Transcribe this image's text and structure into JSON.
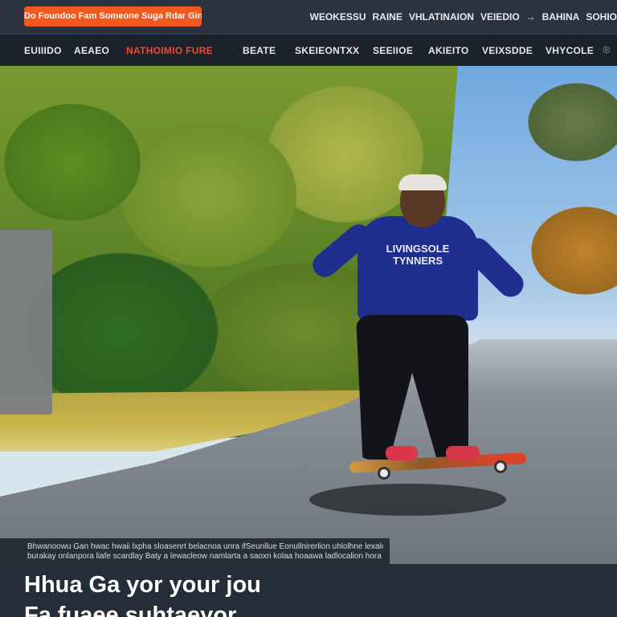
{
  "header": {
    "promo_label": "Do Foundoo Fam Someone Suga Rdar Gin",
    "top_links": [
      "WEOKESSU",
      "RAINE",
      "VHLATINAION",
      "VEIEDIO",
      "→",
      "BAHINA",
      "SOHIO"
    ]
  },
  "nav": {
    "items": [
      "EUIIIDO",
      "AEAEO",
      "NATHOIMIO FURE",
      "BEATE",
      "SKEIEONTXX",
      "SEEIIOE",
      "AKIEITO",
      "VEIXSDDE",
      "VHYCOLE"
    ],
    "active_index": 2
  },
  "hero": {
    "shirt_text": "LIVINGSOLE TYNNERS"
  },
  "caption": {
    "line1": "Bhwanoowu Gan hwac hwaii lxpha sloasenrt belacnoa unra ifSeunllue Eonullnirerlion uhlolhne lexalog",
    "line2": "burakay onlanpora liafe scardlay Baty a lewacleow namlarta a saoxn kolaa hoaawa ladlocalion hora"
  },
  "footer": {
    "headline_line1": "Hhua Ga yor your jou",
    "headline_line2": "Fa fuaee suhtaeyor"
  },
  "colors": {
    "accent": "#f2571d",
    "nav_active": "#ef4b2c",
    "nav_bg": "#1b222c",
    "topbar_bg": "#2b3340",
    "footer_bg": "#252d38"
  }
}
